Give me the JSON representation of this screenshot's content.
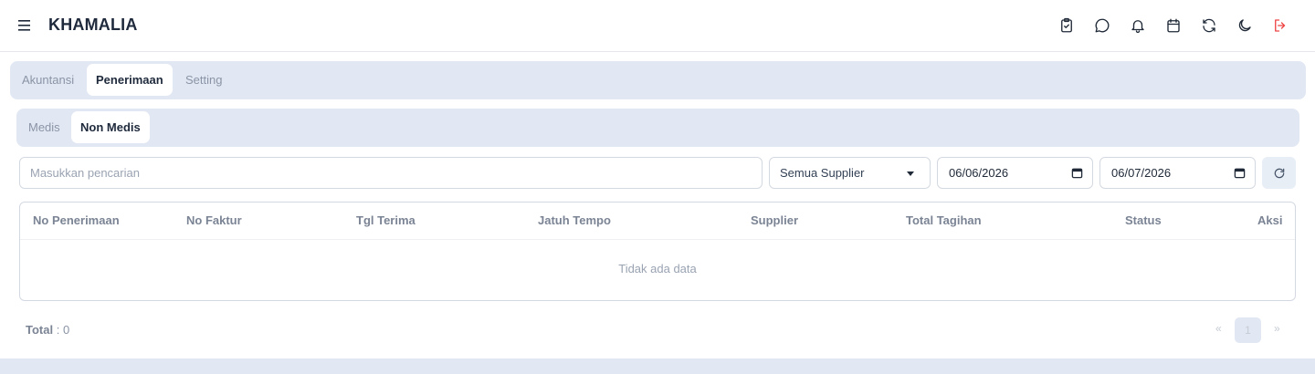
{
  "app": {
    "title": "KHAMALIA"
  },
  "header": {
    "icons": [
      "clipboard-check-icon",
      "chat-icon",
      "bell-icon",
      "calendar-icon",
      "refresh-icon",
      "moon-icon",
      "logout-icon"
    ],
    "logout_color": "#ef4444"
  },
  "tabs_main": [
    {
      "label": "Akuntansi",
      "active": false
    },
    {
      "label": "Penerimaan",
      "active": true
    },
    {
      "label": "Setting",
      "active": false
    }
  ],
  "tabs_sub": [
    {
      "label": "Medis",
      "active": false
    },
    {
      "label": "Non Medis",
      "active": true
    }
  ],
  "filters": {
    "search_placeholder": "Masukkan pencarian",
    "supplier_selected": "Semua Supplier",
    "date_from": "06/06/2026",
    "date_to": "06/07/2026"
  },
  "table": {
    "columns": [
      "No Penerimaan",
      "No Faktur",
      "Tgl Terima",
      "Jatuh Tempo",
      "Supplier",
      "Total Tagihan",
      "Status",
      "Aksi"
    ],
    "rows": [],
    "empty_text": "Tidak ada data"
  },
  "footer": {
    "total_label": "Total",
    "total_value": ": 0",
    "pagination": {
      "prev": "«",
      "current": "1",
      "next": "»"
    }
  },
  "colors": {
    "accent_bg": "#e2e8f3",
    "text_dark": "#1e293b"
  }
}
